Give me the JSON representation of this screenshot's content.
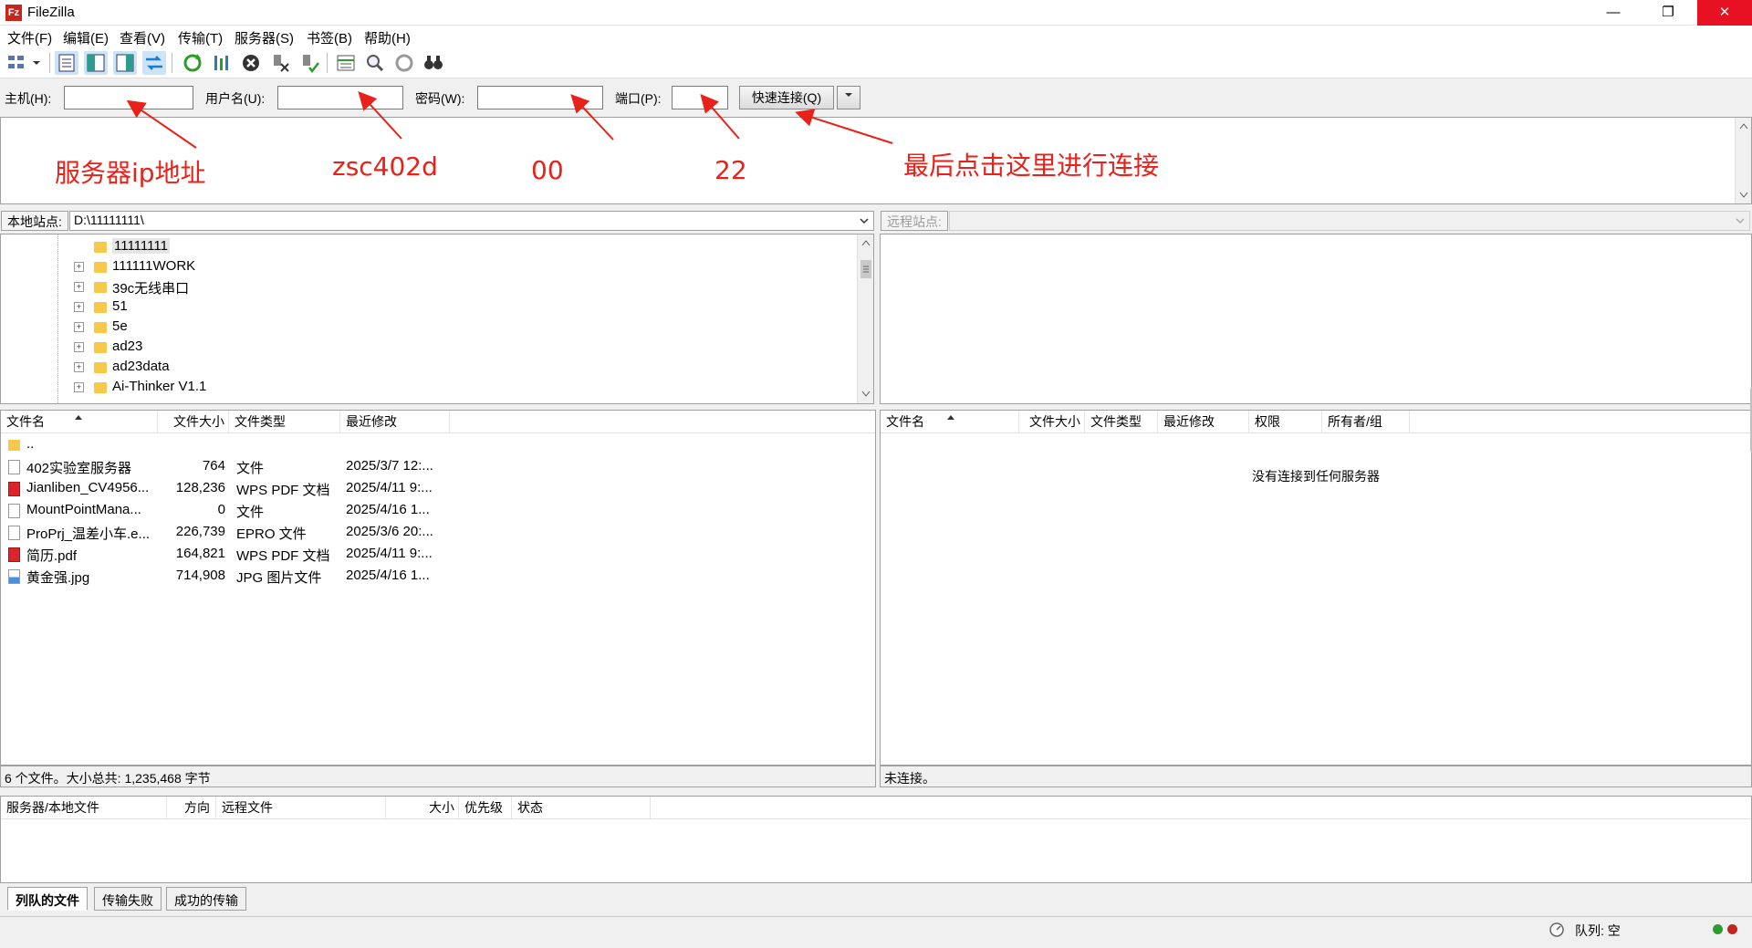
{
  "window": {
    "title": "FileZilla",
    "app_icon": "Fz",
    "controls": {
      "minimize": "—",
      "restore": "❐",
      "close": "✕"
    }
  },
  "menu": [
    "文件(F)",
    "编辑(E)",
    "查看(V)",
    "传输(T)",
    "服务器(S)",
    "书签(B)",
    "帮助(H)"
  ],
  "quickconnect": {
    "host_label": "主机(H):",
    "host_value": "",
    "user_label": "用户名(U):",
    "user_value": "",
    "pass_label": "密码(W):",
    "pass_value": "",
    "port_label": "端口(P):",
    "port_value": "",
    "connect_button": "快速连接(Q)"
  },
  "annotations": {
    "host": "服务器ip地址",
    "user": "zsc402d",
    "pass": "00",
    "port": "22",
    "connect": "最后点击这里进行连接",
    "color": "#e8221a"
  },
  "local": {
    "site_label": "本地站点:",
    "path": "D:\\11111111\\",
    "tree": [
      {
        "name": "11111111",
        "expandable": false,
        "selected": true
      },
      {
        "name": "111111WORK",
        "expandable": true
      },
      {
        "name": "39c无线串口",
        "expandable": true
      },
      {
        "name": "51",
        "expandable": true
      },
      {
        "name": "5e",
        "expandable": true
      },
      {
        "name": "ad23",
        "expandable": true
      },
      {
        "name": "ad23data",
        "expandable": true
      },
      {
        "name": "Ai-Thinker V1.1",
        "expandable": true
      }
    ],
    "columns": [
      "文件名",
      "文件大小",
      "文件类型",
      "最近修改"
    ],
    "files": [
      {
        "name": "..",
        "size": "",
        "type": "",
        "modified": "",
        "icon": "folder"
      },
      {
        "name": "402实验室服务器",
        "size": "764",
        "type": "文件",
        "modified": "2025/3/7 12:...",
        "icon": "file"
      },
      {
        "name": "Jianliben_CV4956...",
        "size": "128,236",
        "type": "WPS PDF 文档",
        "modified": "2025/4/11 9:...",
        "icon": "pdf"
      },
      {
        "name": "MountPointMana...",
        "size": "0",
        "type": "文件",
        "modified": "2025/4/16 1...",
        "icon": "file"
      },
      {
        "name": "ProPrj_温差小车.e...",
        "size": "226,739",
        "type": "EPRO 文件",
        "modified": "2025/3/6 20:...",
        "icon": "file"
      },
      {
        "name": "简历.pdf",
        "size": "164,821",
        "type": "WPS PDF 文档",
        "modified": "2025/4/11 9:...",
        "icon": "pdf"
      },
      {
        "name": "黄金强.jpg",
        "size": "714,908",
        "type": "JPG 图片文件",
        "modified": "2025/4/16 1...",
        "icon": "image"
      }
    ],
    "status": "6 个文件。大小总共: 1,235,468 字节"
  },
  "remote": {
    "site_label": "远程站点:",
    "path": "",
    "columns": [
      "文件名",
      "文件大小",
      "文件类型",
      "最近修改",
      "权限",
      "所有者/组"
    ],
    "empty_message": "没有连接到任何服务器",
    "status": "未连接。"
  },
  "queue": {
    "columns": [
      "服务器/本地文件",
      "方向",
      "远程文件",
      "大小",
      "优先级",
      "状态"
    ],
    "tabs": [
      "列队的文件",
      "传输失败",
      "成功的传输"
    ],
    "active_tab": "列队的文件"
  },
  "statusbar": {
    "queue_label": "队列: 空",
    "led_green": "#2a9d2a",
    "led_red": "#c0261d"
  }
}
